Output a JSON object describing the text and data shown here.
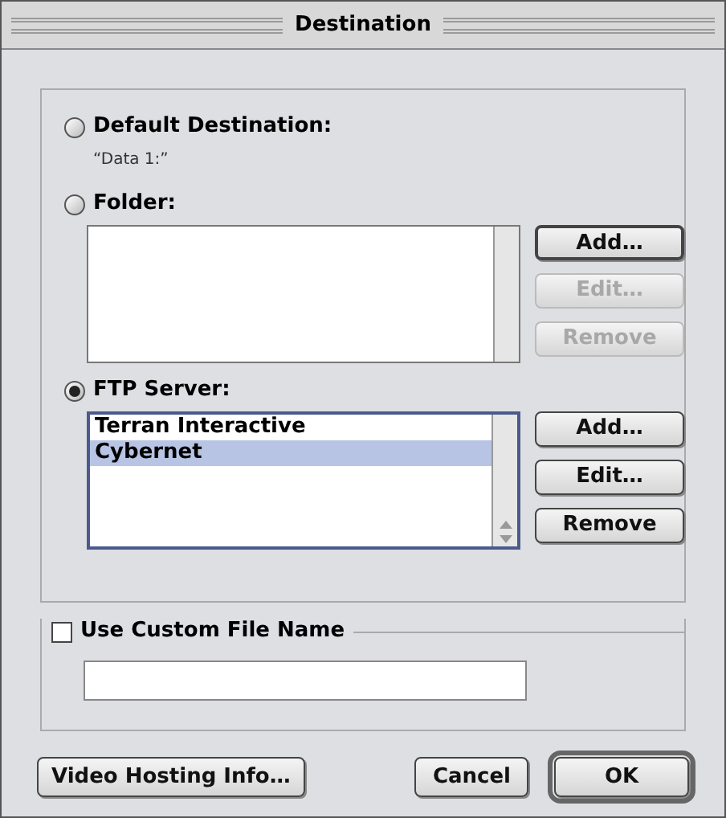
{
  "window": {
    "title": "Destination"
  },
  "options": [
    {
      "label": "Default Destination:",
      "selected": false,
      "path": "“Data 1:”"
    },
    {
      "label": "Folder:",
      "selected": false,
      "buttons": [
        {
          "label": "Add…",
          "disabled": false,
          "default": true
        },
        {
          "label": "Edit…",
          "disabled": true,
          "default": false
        },
        {
          "label": "Remove",
          "disabled": true,
          "default": false
        }
      ]
    },
    {
      "label": "FTP Server:",
      "selected": true,
      "list_items": [
        {
          "label": "Terran Interactive",
          "selected": false
        },
        {
          "label": "Cybernet",
          "selected": true
        }
      ],
      "buttons": [
        {
          "label": "Add…",
          "disabled": false,
          "default": false
        },
        {
          "label": "Edit…",
          "disabled": false,
          "default": false
        },
        {
          "label": "Remove",
          "disabled": false,
          "default": false
        }
      ]
    }
  ],
  "custom_file_name": {
    "label": "Use Custom File Name",
    "checked": false
  },
  "footer_buttons": [
    {
      "label": "Video Hosting Info…",
      "default": false
    },
    {
      "label": "Cancel",
      "default": false
    },
    {
      "label": "OK",
      "default": true
    }
  ]
}
